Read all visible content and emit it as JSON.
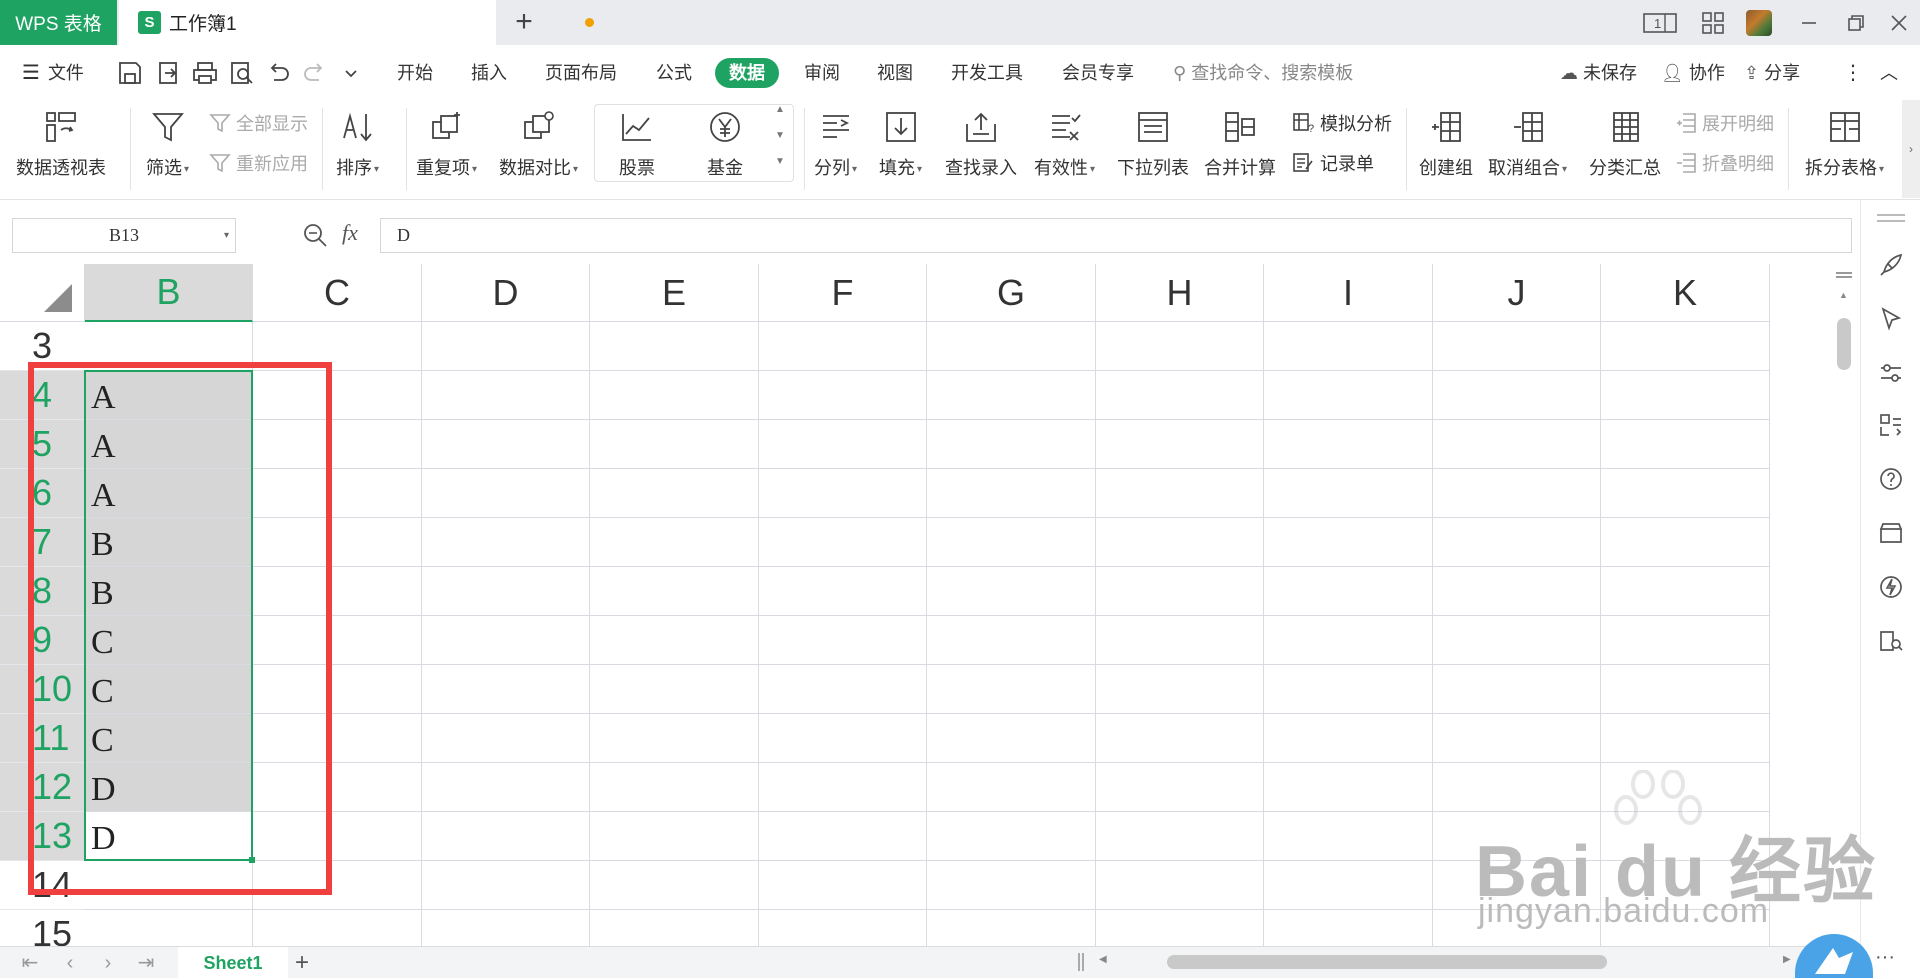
{
  "titlebar": {
    "app_name": "WPS 表格",
    "doc_tab": "工作簿1",
    "doc_icon_letter": "S",
    "new_tab": "+"
  },
  "menu": {
    "file": "文件",
    "items": [
      "开始",
      "插入",
      "页面布局",
      "公式",
      "数据",
      "审阅",
      "视图",
      "开发工具",
      "会员专享"
    ],
    "active": "数据",
    "search_placeholder": "查找命令、搜索模板",
    "unsaved": "未保存",
    "collaborate": "协作",
    "share": "分享"
  },
  "ribbon": {
    "pivot": "数据透视表",
    "filter": "筛选",
    "show_all": "全部显示",
    "reapply": "重新应用",
    "sort": "排序",
    "duplicates": "重复项",
    "compare": "数据对比",
    "stock": "股票",
    "fund": "基金",
    "split": "分列",
    "fill": "填充",
    "lookup": "查找录入",
    "validity": "有效性",
    "dropdown": "下拉列表",
    "consolidate": "合并计算",
    "simulate": "模拟分析",
    "record": "记录单",
    "group": "创建组",
    "ungroup": "取消组合",
    "subtotal": "分类汇总",
    "expand": "展开明细",
    "collapse": "折叠明细",
    "split_table": "拆分表格"
  },
  "formula_bar": {
    "name_box": "B13",
    "fx": "fx",
    "content": "D"
  },
  "grid": {
    "columns": [
      "B",
      "C",
      "D",
      "E",
      "F",
      "G",
      "H",
      "I",
      "J",
      "K"
    ],
    "selected_column": "B",
    "rows": [
      {
        "num": "3",
        "B": ""
      },
      {
        "num": "4",
        "B": "A"
      },
      {
        "num": "5",
        "B": "A"
      },
      {
        "num": "6",
        "B": "A"
      },
      {
        "num": "7",
        "B": "B"
      },
      {
        "num": "8",
        "B": "B"
      },
      {
        "num": "9",
        "B": "C"
      },
      {
        "num": "10",
        "B": "C"
      },
      {
        "num": "11",
        "B": "C"
      },
      {
        "num": "12",
        "B": "D"
      },
      {
        "num": "13",
        "B": "D"
      },
      {
        "num": "14",
        "B": ""
      },
      {
        "num": "15",
        "B": ""
      }
    ]
  },
  "sheets": {
    "tabs": [
      "Sheet1"
    ],
    "add": "+"
  },
  "watermark": {
    "brand": "Bai du 经验",
    "url": "jingyan.baidu.com"
  },
  "colors": {
    "accent": "#1ea362",
    "annotation": "#ef3f3f",
    "selection": "#d6d6d6"
  }
}
